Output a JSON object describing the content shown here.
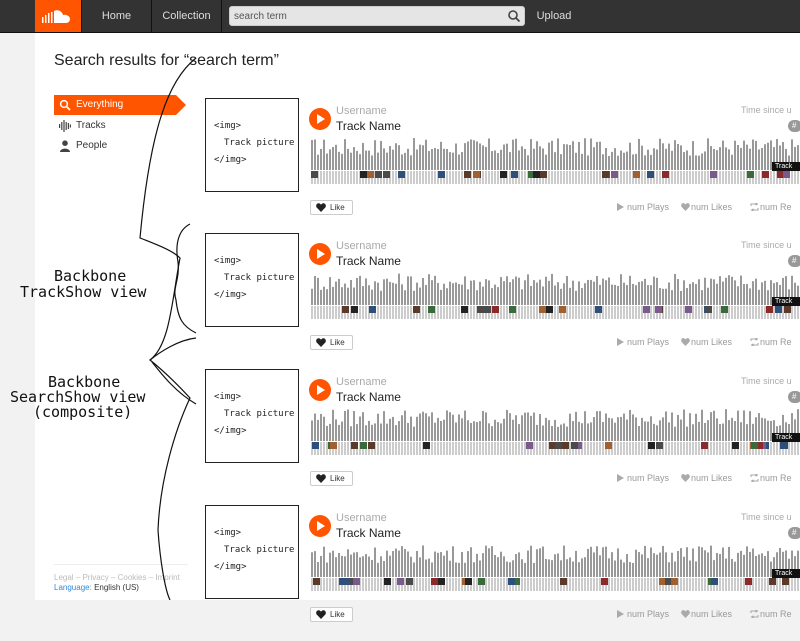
{
  "header": {
    "logo_icon": "soundcloud-cloud-icon",
    "nav": [
      {
        "label": "Home"
      },
      {
        "label": "Collection"
      }
    ],
    "search": {
      "value": "search term",
      "placeholder": "search term",
      "icon": "search-icon"
    },
    "upload_label": "Upload"
  },
  "colors": {
    "accent": "#ff5500",
    "header_bg": "#333333"
  },
  "main": {
    "title": "Search results for “search term”"
  },
  "sidebar": {
    "items": [
      {
        "label": "Everything",
        "icon": "search-icon",
        "active": true
      },
      {
        "label": "Tracks",
        "icon": "waveform-icon",
        "active": false
      },
      {
        "label": "People",
        "icon": "person-icon",
        "active": false
      }
    ],
    "footer_links": "Legal – Privacy – Cookies – Imprint",
    "language_label": "Language:",
    "language_value": "English (US)"
  },
  "tracks": [
    {
      "art_lines": [
        "<img>",
        "Track picture",
        "</img>"
      ],
      "username": "Username",
      "track_name": "Track Name",
      "time_since": "Time since u",
      "tag": "#",
      "wave_label": "Track",
      "like_label": "Like",
      "plays_label": "num Plays",
      "likes_label": "num Likes",
      "reposts_label": "num Re"
    },
    {
      "art_lines": [
        "<img>",
        "Track picture",
        "</img>"
      ],
      "username": "Username",
      "track_name": "Track Name",
      "time_since": "Time since u",
      "tag": "#",
      "wave_label": "Track",
      "like_label": "Like",
      "plays_label": "num Plays",
      "likes_label": "num Likes",
      "reposts_label": "num Re"
    },
    {
      "art_lines": [
        "<img>",
        "Track picture",
        "</img>"
      ],
      "username": "Username",
      "track_name": "Track Name",
      "time_since": "Time since u",
      "tag": "#",
      "wave_label": "Track",
      "like_label": "Like",
      "plays_label": "num Plays",
      "likes_label": "num Likes",
      "reposts_label": "num Re"
    },
    {
      "art_lines": [
        "<img>",
        "Track picture",
        "</img>"
      ],
      "username": "Username",
      "track_name": "Track Name",
      "time_since": "Time since u",
      "tag": "#",
      "wave_label": "Track",
      "like_label": "Like",
      "plays_label": "num Plays",
      "likes_label": "num Likes",
      "reposts_label": "num Re"
    }
  ],
  "annotations": {
    "trackshow": [
      "Backbone",
      "TrackShow view"
    ],
    "searchshow": [
      "Backbone",
      "SearchShow view",
      "(composite)"
    ]
  }
}
